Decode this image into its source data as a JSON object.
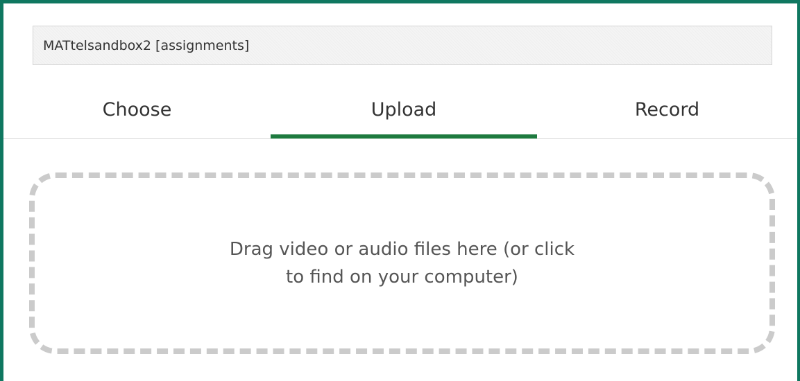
{
  "folder": {
    "value": "MATtelsandbox2 [assignments]"
  },
  "tabs": [
    {
      "label": "Choose",
      "selected": false
    },
    {
      "label": "Upload",
      "selected": true
    },
    {
      "label": "Record",
      "selected": false
    }
  ],
  "dropzone": {
    "text": "Drag video or audio files here (or click to find on your computer)"
  },
  "colors": {
    "frame_border": "#0f7760",
    "active_tab_underline": "#1e7a3f",
    "dropzone_border": "#cbcbcb"
  }
}
